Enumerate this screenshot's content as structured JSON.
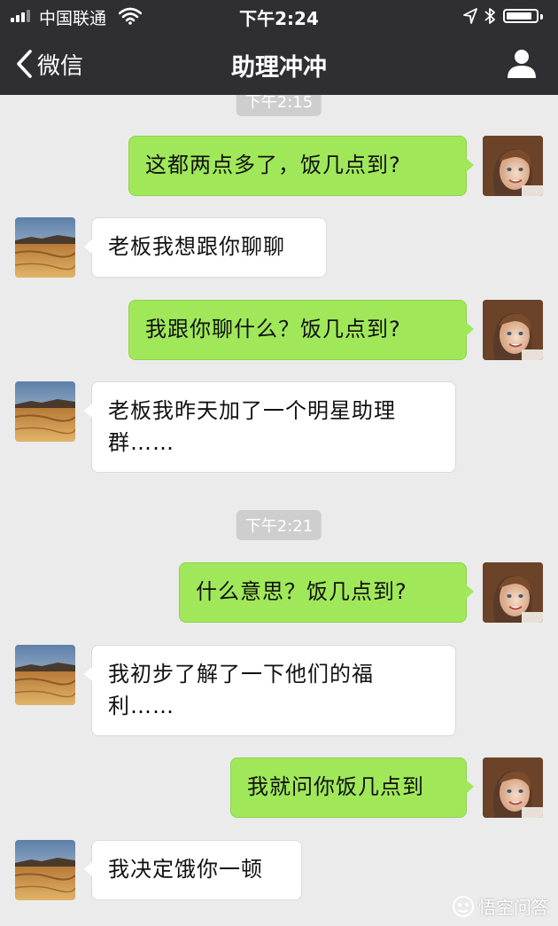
{
  "status_bar": {
    "carrier": "中国联通",
    "time": "下午2:24"
  },
  "nav": {
    "back_label": "微信",
    "title": "助理冲冲"
  },
  "chat": {
    "timestamps": [
      "下午2:15",
      "下午2:21"
    ],
    "messages": [
      {
        "from": "me",
        "text": "这都两点多了，饭几点到?"
      },
      {
        "from": "assistant",
        "text": "老板我想跟你聊聊"
      },
      {
        "from": "me",
        "text": "我跟你聊什么？饭几点到?"
      },
      {
        "from": "assistant",
        "text": "老板我昨天加了一个明星助理群……"
      },
      {
        "from": "me",
        "text": "什么意思？饭几点到?"
      },
      {
        "from": "assistant",
        "text": "我初步了解了一下他们的福利……"
      },
      {
        "from": "me",
        "text": "我就问你饭几点到"
      },
      {
        "from": "assistant",
        "text": "我决定饿你一顿"
      }
    ]
  },
  "watermark": {
    "text": "悟空问答"
  },
  "colors": {
    "topbar": "#2f2f33",
    "background": "#ebebeb",
    "outgoing_bubble": "#a0e85a",
    "incoming_bubble": "#ffffff",
    "timestamp_bg": "#cecece"
  },
  "icons": {
    "back": "chevron-left-icon",
    "profile": "person-icon",
    "signal": "signal-bars-icon",
    "wifi": "wifi-icon",
    "location": "location-arrow-icon",
    "bluetooth": "bluetooth-icon",
    "battery": "battery-icon"
  }
}
